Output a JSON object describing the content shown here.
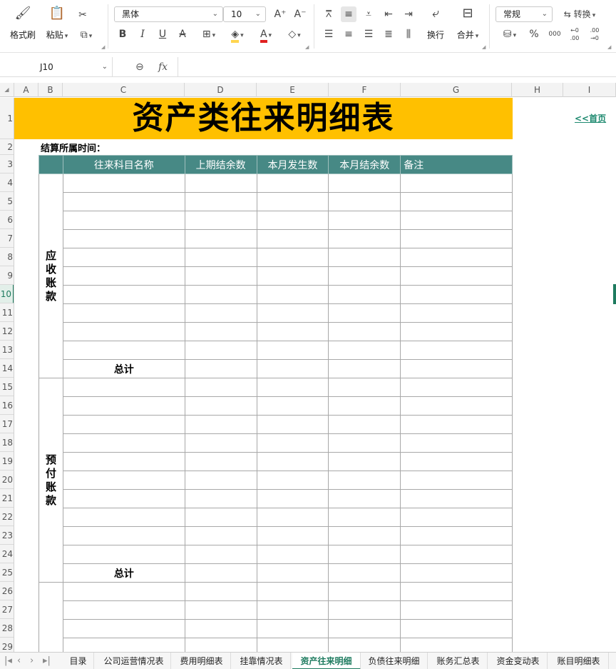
{
  "ribbon": {
    "format_painter": "格式刷",
    "paste": "粘贴",
    "font_name": "黑体",
    "font_size": "10",
    "wrap_text": "换行",
    "merge": "合并",
    "number_format": "常规",
    "convert": "转换",
    "bold": "B",
    "italic": "I",
    "underline": "U",
    "strike": "A",
    "font_color": "A",
    "percent": "%",
    "thousands": "000",
    "inc_decimal": "←0 .00",
    "dec_decimal": ".00 →0",
    "fill_color": "#ffd54f",
    "font_color_hex": "#e02020"
  },
  "formula_bar": {
    "cell_ref": "J10",
    "fx": "fx",
    "zoom_icon": "⊖"
  },
  "columns": [
    "A",
    "B",
    "C",
    "D",
    "E",
    "F",
    "G",
    "H",
    "I"
  ],
  "rows": [
    "1",
    "2",
    "3",
    "4",
    "5",
    "6",
    "7",
    "8",
    "9",
    "10",
    "11",
    "12",
    "13",
    "14",
    "15",
    "16",
    "17",
    "18",
    "19",
    "20",
    "21",
    "22",
    "23",
    "24",
    "25",
    "26",
    "27",
    "28",
    "29"
  ],
  "active_row": "10",
  "sheet": {
    "title": "资产类往来明细表",
    "home_link": "<<首页",
    "period_label": "结算所属时间：",
    "headers": [
      "往来科目名称",
      "上期结余数",
      "本月发生数",
      "本月结余数",
      "备注"
    ],
    "sections": [
      {
        "label": "应收账款",
        "total": "总计"
      },
      {
        "label": "预付账款",
        "total": "总计"
      }
    ]
  },
  "tabs": {
    "items": [
      "目录",
      "公司运营情况表",
      "费用明细表",
      "挂靠情况表",
      "资产往来明细",
      "负债往来明细",
      "账务汇总表",
      "资金变动表",
      "账目明细表"
    ],
    "active": "资产往来明细"
  }
}
